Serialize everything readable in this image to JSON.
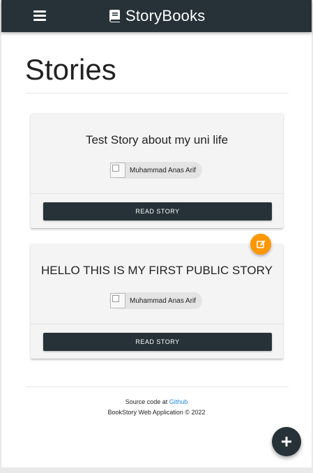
{
  "navbar": {
    "menu_icon": "hamburger-menu-icon",
    "brand_icon": "book-icon",
    "brand_title": "StoryBooks",
    "background_color": "#263238"
  },
  "main": {
    "page_title": "Stories",
    "stories": [
      {
        "title": "Test Story about my uni life",
        "author": "Muhammad Anas Arif",
        "read_label": "READ STORY",
        "editable": false
      },
      {
        "title": "HELLO THIS IS MY FIRST PUBLIC STORY",
        "author": "Muhammad Anas Arif",
        "read_label": "READ STORY",
        "editable": true,
        "edit_icon": "edit-icon"
      }
    ]
  },
  "footer": {
    "source_prefix": "Source code at",
    "source_link": "Github",
    "copyright": "BookStory Web Application © 2022"
  },
  "add_button": {
    "icon": "plus-icon"
  },
  "colors": {
    "primary": "#263238",
    "edit_accent": "#ff9800",
    "link": "#1e88e5",
    "card_background": "#f4f4f4"
  }
}
